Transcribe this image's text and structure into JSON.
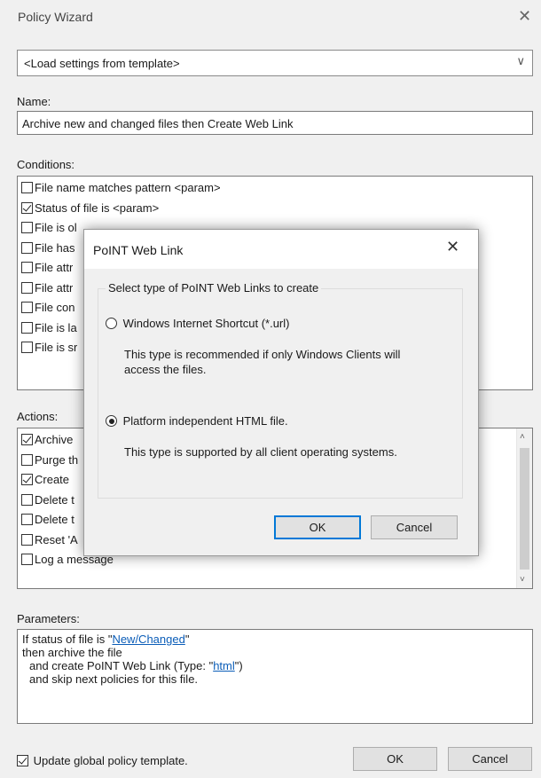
{
  "window": {
    "title": "Policy Wizard",
    "close_glyph": "✕"
  },
  "template_combo": {
    "value": "<Load settings from template>",
    "chevron": "∨"
  },
  "name": {
    "label": "Name:",
    "value": "Archive new and changed files then Create Web Link"
  },
  "conditions": {
    "label": "Conditions:",
    "items": [
      {
        "label": "File name matches pattern <param>",
        "checked": false
      },
      {
        "label": "Status of file is <param>",
        "checked": true
      },
      {
        "label": "File is ol",
        "checked": false
      },
      {
        "label": "File has",
        "checked": false
      },
      {
        "label": "File attr",
        "checked": false
      },
      {
        "label": "File attr",
        "checked": false
      },
      {
        "label": "File con",
        "checked": false
      },
      {
        "label": "File is la",
        "checked": false
      },
      {
        "label": "File is sr",
        "checked": false
      }
    ]
  },
  "actions": {
    "label": "Actions:",
    "items": [
      {
        "label": "Archive",
        "checked": true
      },
      {
        "label": "Purge th",
        "checked": false
      },
      {
        "label": "Create",
        "checked": true
      },
      {
        "label": "Delete t",
        "checked": false
      },
      {
        "label": "Delete t",
        "checked": false
      },
      {
        "label": "Reset 'A",
        "checked": false
      },
      {
        "label": "Log a message",
        "checked": false
      }
    ],
    "scroll_up": "˄",
    "scroll_down": "˅"
  },
  "parameters": {
    "label": "Parameters:",
    "line1_prefix": "If status of file is \"",
    "line1_link": "New/Changed",
    "line1_suffix": "\"",
    "line2": "then archive the file",
    "line3_prefix": "and create PoINT Web Link (Type: \"",
    "line3_link": "html",
    "line3_suffix": "\")",
    "line4": "and skip next policies for this file."
  },
  "footer": {
    "update_template_label": "Update global policy template.",
    "update_template_checked": true,
    "ok_label": "OK",
    "cancel_label": "Cancel"
  },
  "modal": {
    "title": "PoINT Web Link",
    "close_glyph": "✕",
    "group_label": "Select type of PoINT Web Links to create",
    "option1_label": "Windows Internet Shortcut (*.url)",
    "option1_desc_line1": "This type is recommended if only Windows Clients will",
    "option1_desc_line2": "access the files.",
    "option2_label": "Platform independent HTML file.",
    "option2_desc": "This type is supported by all client operating systems.",
    "selected_option": 2,
    "ok_label": "OK",
    "cancel_label": "Cancel"
  }
}
